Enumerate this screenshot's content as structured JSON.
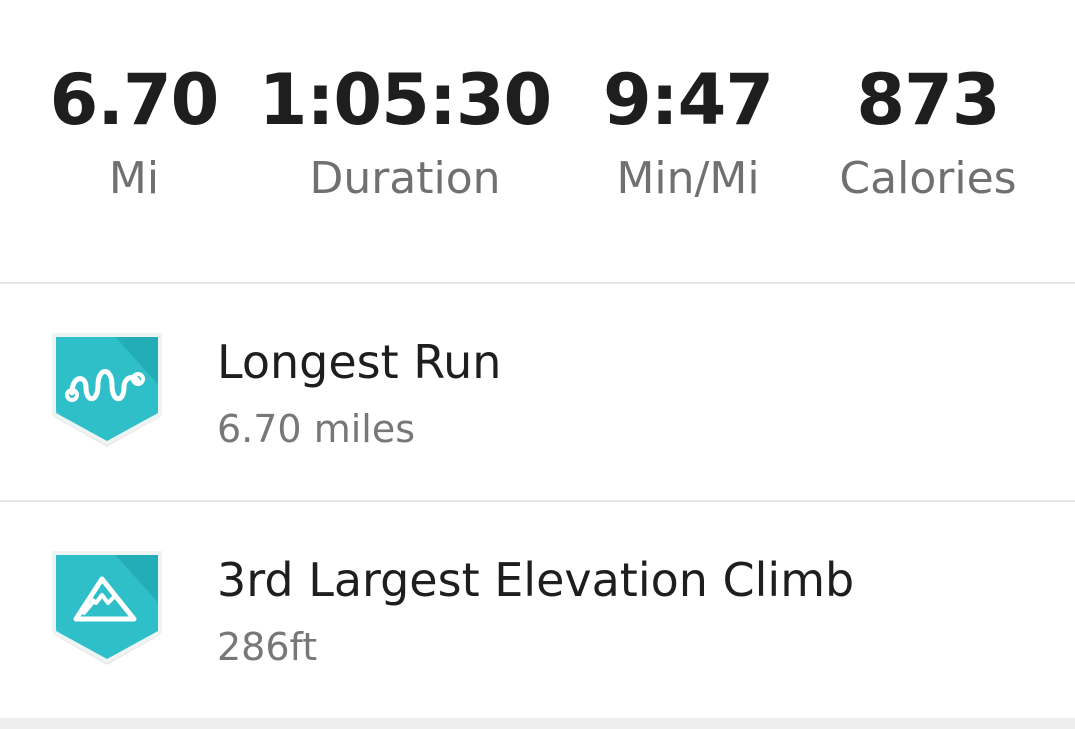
{
  "stats": [
    {
      "value": "6.70",
      "label": "Mi"
    },
    {
      "value": "1:05:30",
      "label": "Duration"
    },
    {
      "value": "9:47",
      "label": "Min/Mi"
    },
    {
      "value": "873",
      "label": "Calories"
    }
  ],
  "achievements": [
    {
      "icon": "route-wave-icon",
      "title": "Longest Run",
      "subtitle": "6.70 miles"
    },
    {
      "icon": "mountain-icon",
      "title": "3rd Largest Elevation Climb",
      "subtitle": "286ft"
    }
  ],
  "colors": {
    "badge_primary": "#2fbfc9",
    "badge_dark": "#1a9ea8",
    "badge_light": "#5fd3db",
    "value_text": "#1e1e1e",
    "label_text": "#707070",
    "divider": "#e6e6e6"
  }
}
